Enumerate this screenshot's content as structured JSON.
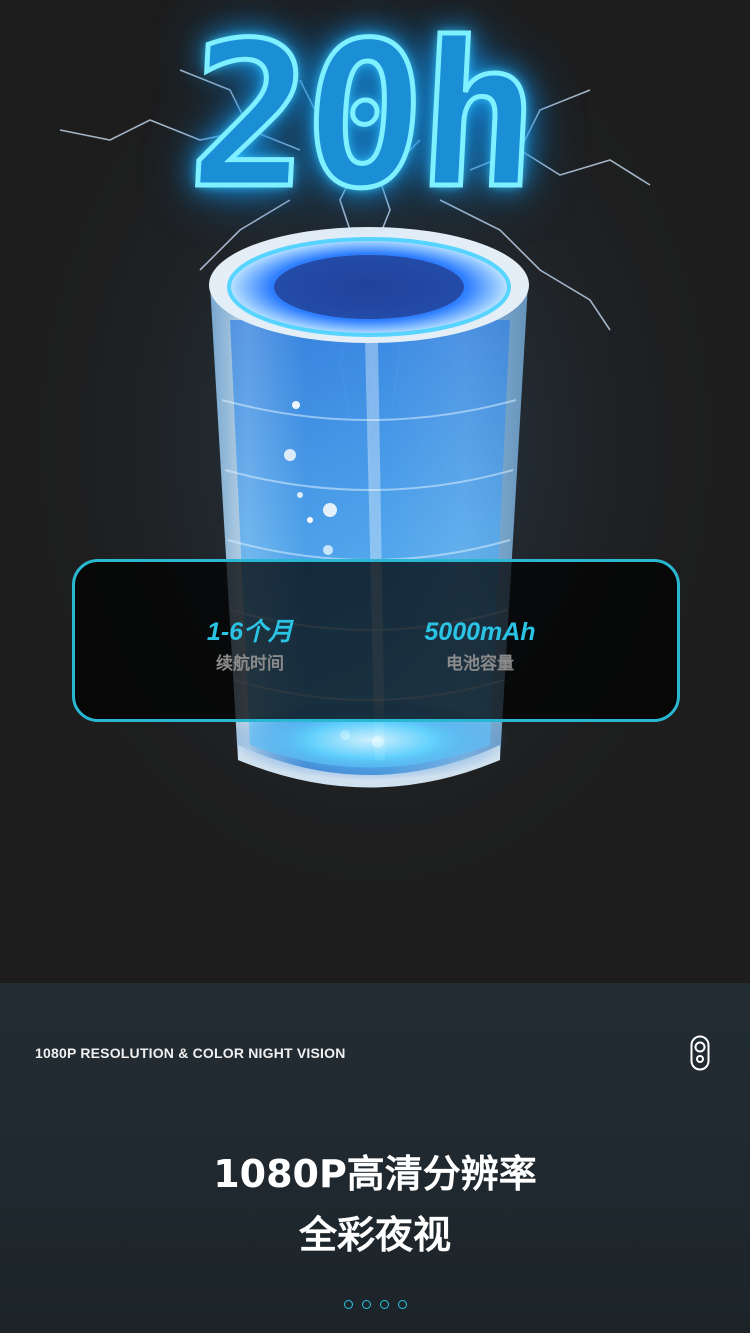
{
  "hero": {
    "headline": "20h",
    "stats": [
      {
        "value": "1-6个月",
        "label": "续航时间"
      },
      {
        "value": "5000mAh",
        "label": "电池容量"
      }
    ]
  },
  "feature": {
    "subtitle_en": "1080P RESOLUTION & COLOR NIGHT VISION",
    "icon": "camera-icon",
    "title_line1": "1080P高清分辨率",
    "title_line2": "全彩夜视",
    "pagination_count": 4
  },
  "colors": {
    "accent": "#2bc3e4",
    "background": "#1d1d1d",
    "glow": "#3fd4ff"
  }
}
